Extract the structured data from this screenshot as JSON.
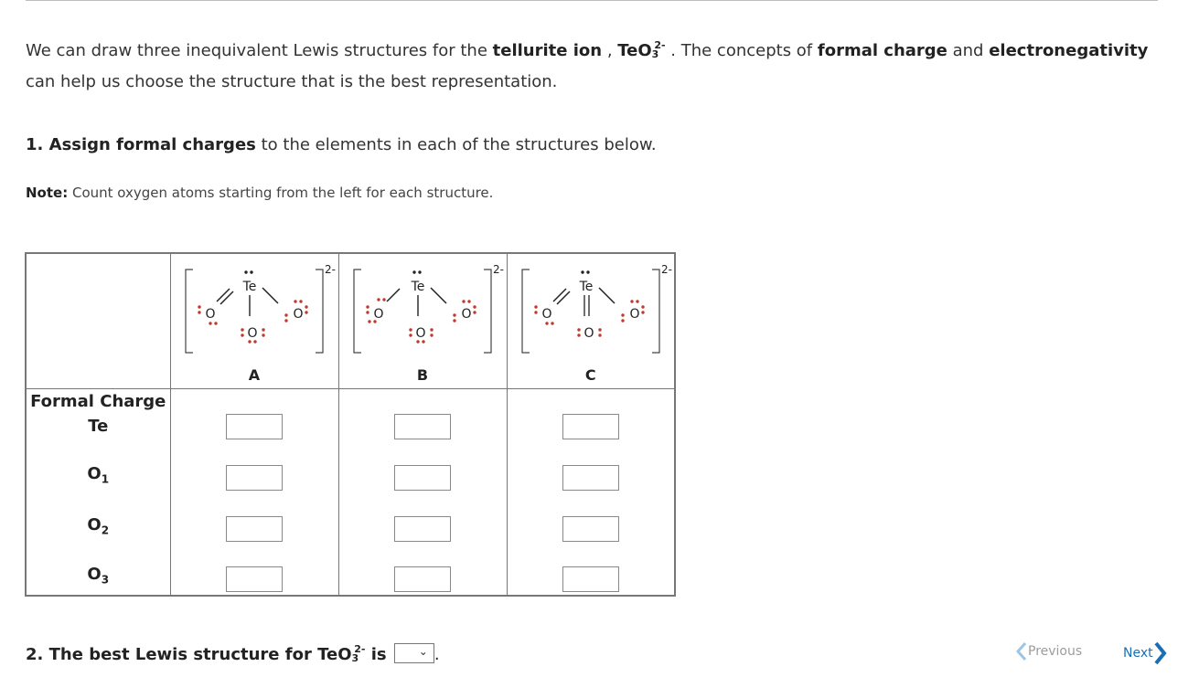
{
  "intro": {
    "part1": "We can draw three inequivalent Lewis structures for the ",
    "ion_name": "tellurite ion",
    "comma": " , ",
    "formula_main": "TeO",
    "formula_sub": "3",
    "formula_sup": "2-",
    "part2": " . The concepts of ",
    "formal_charge": "formal charge",
    "and": " and ",
    "electronegativity": "electronegativity",
    "part3": " can help us choose the structure that is the best representation."
  },
  "question1": {
    "number": "1. ",
    "bold": "Assign formal charges",
    "rest": " to the elements in each of the structures below."
  },
  "note": {
    "bold": "Note:",
    "text": " Count oxygen atoms starting from the left for each structure."
  },
  "table": {
    "header_label": "Formal Charge",
    "rows": [
      "Te",
      "O",
      "O",
      "O"
    ],
    "row_subs": [
      "",
      "1",
      "2",
      "3"
    ],
    "structures": [
      {
        "label": "A",
        "charge": "2-",
        "te": "Te",
        "o": "O"
      },
      {
        "label": "B",
        "charge": "2-",
        "te": "Te",
        "o": "O"
      },
      {
        "label": "C",
        "charge": "2-",
        "te": "Te",
        "o": "O"
      }
    ]
  },
  "question2": {
    "text_bold": "2. The best Lewis structure for TeO",
    "sub": "3",
    "sup": "2-",
    "is": " is",
    "select_value": "",
    "period": "."
  },
  "nav": {
    "previous": "Previous",
    "next": "Next"
  }
}
